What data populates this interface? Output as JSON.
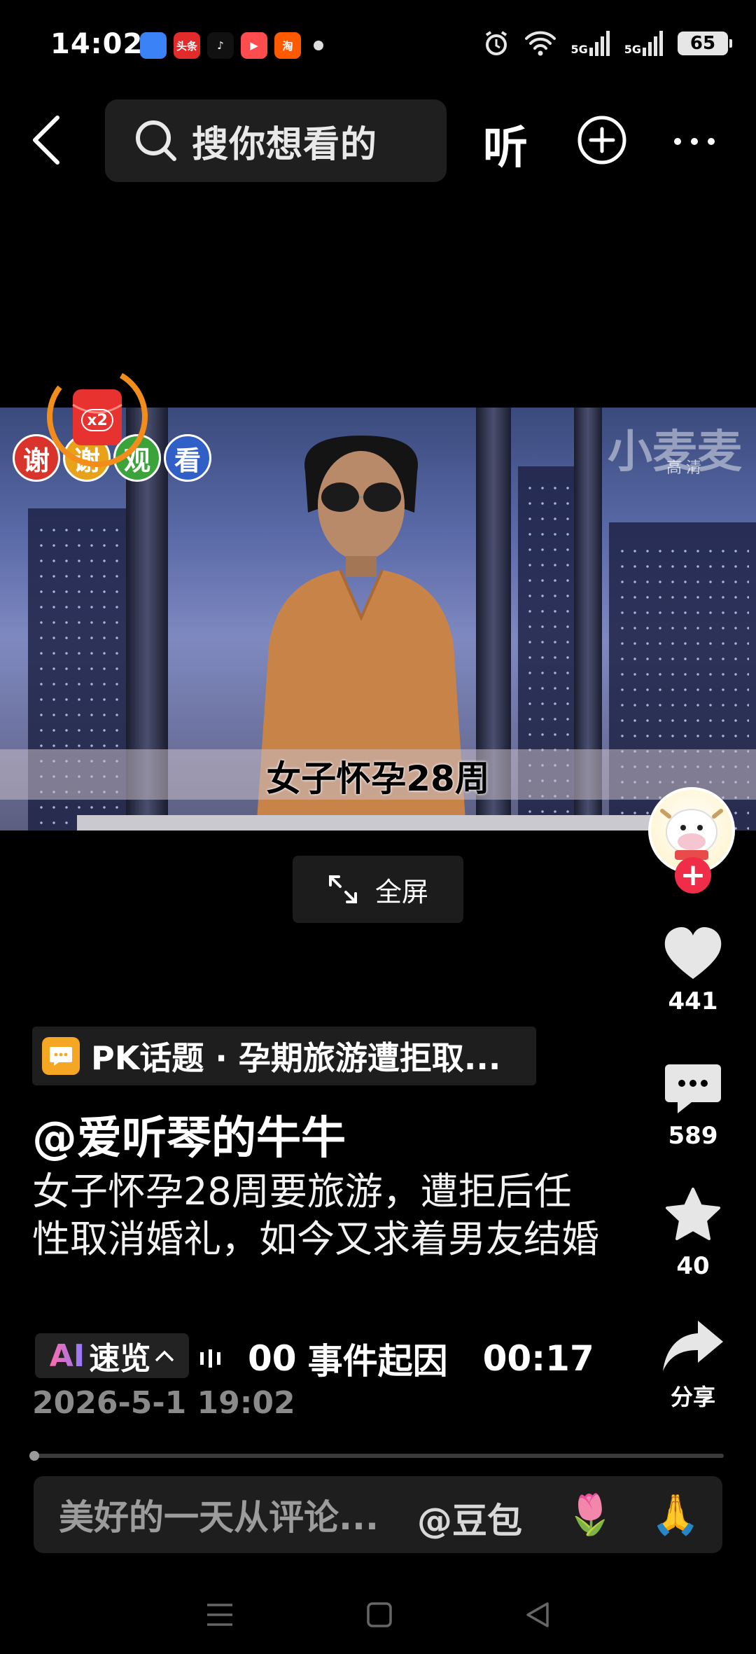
{
  "status_bar": {
    "time": "14:02",
    "app_icons": [
      {
        "name": "blue-app-icon",
        "color": "#3b82f6",
        "label": ""
      },
      {
        "name": "toutiao-app-icon",
        "color": "#e22b2b",
        "label": "头条"
      },
      {
        "name": "douyin-app-icon",
        "color": "#111111",
        "label": ""
      },
      {
        "name": "video-app-icon",
        "color": "#ff4d4f",
        "label": ""
      },
      {
        "name": "taobao-app-icon",
        "color": "#ff5a00",
        "label": "淘"
      }
    ],
    "signal_label_1": "5G",
    "signal_label_2": "5G",
    "battery": "65"
  },
  "top_bar": {
    "search_placeholder": "搜你想看的",
    "listen_label": "听"
  },
  "video": {
    "subtitle": "女子怀孕28周",
    "watermark": "小麦麦",
    "watermark_quality": "高清",
    "thanks_chars": [
      "谢",
      "谢",
      "观",
      "看"
    ],
    "thanks_colors": [
      "#d9342b",
      "#e8a21a",
      "#3ca33a",
      "#2f5fc7"
    ],
    "redpack_label": "x2",
    "fullscreen_label": "全屏"
  },
  "rail": {
    "like_count": "441",
    "comment_count": "589",
    "favorite_count": "40",
    "share_label": "分享"
  },
  "info": {
    "pk_topic": "PK话题 · 孕期旅游遭拒取...",
    "author": "@爱听琴的牛牛",
    "description": "女子怀孕28周要旅游，遭拒后任性取消婚礼，如今又求着男友结婚",
    "ai_prefix": "AI",
    "ai_label": "速览",
    "ai_ticker_time_a": "00",
    "ai_ticker_text": "事件起因",
    "ai_ticker_time_b": "00:17",
    "date": "2026-5-1 19:02"
  },
  "comment_bar": {
    "placeholder": "美好的一天从评论...",
    "mention": "@豆包",
    "emoji_1": "🌷",
    "emoji_2": "🙏"
  }
}
